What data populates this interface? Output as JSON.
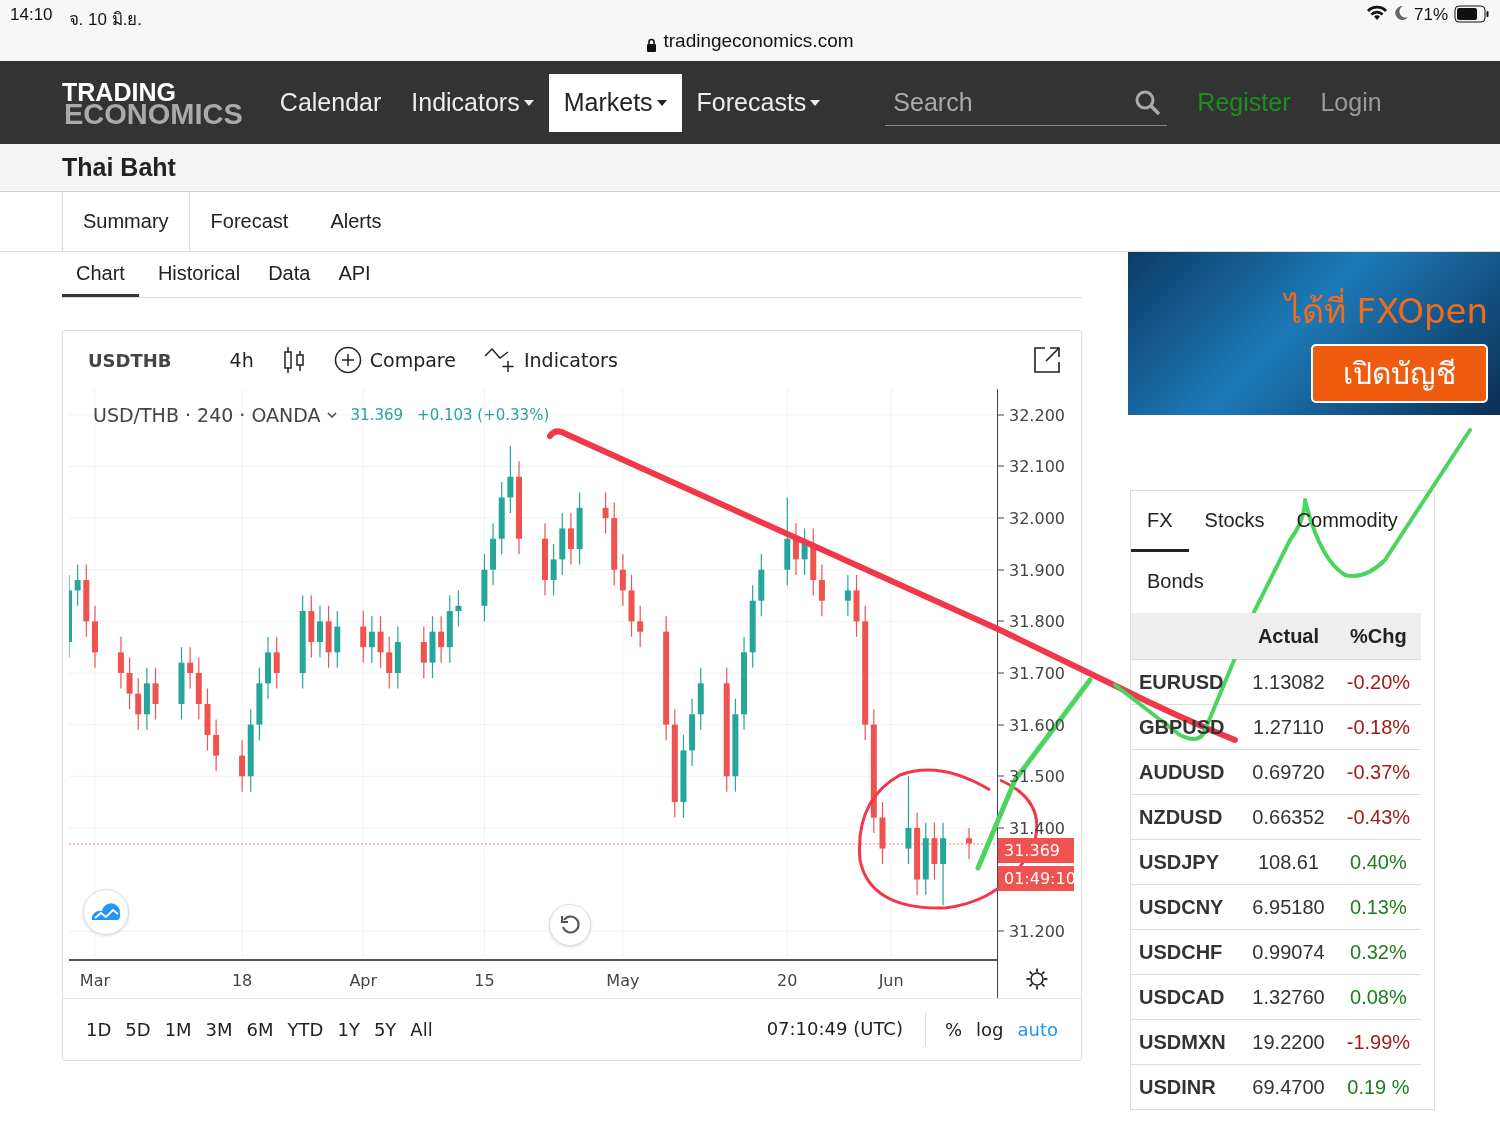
{
  "status_bar": {
    "time": "14:10",
    "date": "จ. 10 มิ.ย.",
    "url": "tradingeconomics.com",
    "battery": "71%"
  },
  "nav": {
    "logo_top": "TRADING",
    "logo_bottom": "ECONOMICS",
    "items": [
      {
        "label": "Calendar",
        "dropdown": false,
        "selected": false
      },
      {
        "label": "Indicators",
        "dropdown": true,
        "selected": false
      },
      {
        "label": "Markets",
        "dropdown": true,
        "selected": true
      },
      {
        "label": "Forecasts",
        "dropdown": true,
        "selected": false
      }
    ],
    "search": {
      "placeholder": "Search"
    },
    "register": "Register",
    "login": "Login"
  },
  "page_title": "Thai Baht",
  "tabs": [
    {
      "label": "Summary",
      "selected": true
    },
    {
      "label": "Forecast",
      "selected": false
    },
    {
      "label": "Alerts",
      "selected": false
    }
  ],
  "subtabs": [
    {
      "label": "Chart",
      "selected": true
    },
    {
      "label": "Historical",
      "selected": false
    },
    {
      "label": "Data",
      "selected": false
    },
    {
      "label": "API",
      "selected": false
    }
  ],
  "chart_widget": {
    "symbol": "USDTHB",
    "interval": "4h",
    "compare": "Compare",
    "indicators": "Indicators",
    "legend": {
      "title": "USD/THB · 240 · OANDA",
      "price": "31.369",
      "change": "+0.103 (+0.33%)"
    },
    "chart_data": {
      "type": "candlestick",
      "ylim": [
        31.15,
        32.25
      ],
      "grid": true,
      "ref_lines": [
        {
          "axis": "y",
          "value": 31.369,
          "color": "#ef5350"
        }
      ],
      "yticks": [
        {
          "value": 32.2,
          "label": "32.200"
        },
        {
          "value": 32.1,
          "label": "32.100"
        },
        {
          "value": 32.0,
          "label": "32.000"
        },
        {
          "value": 31.9,
          "label": "31.900"
        },
        {
          "value": 31.8,
          "label": "31.800"
        },
        {
          "value": 31.7,
          "label": "31.700"
        },
        {
          "value": 31.6,
          "label": "31.600"
        },
        {
          "value": 31.5,
          "label": "31.500"
        },
        {
          "value": 31.4,
          "label": "31.400"
        },
        {
          "value": 31.2,
          "label": "31.200"
        }
      ],
      "xlim": [
        "--02-26",
        "--06-13"
      ],
      "xticks": [
        {
          "value": "--03-01",
          "label": "Mar"
        },
        {
          "value": "--03-18",
          "label": "18"
        },
        {
          "value": "--04-01",
          "label": "Apr"
        },
        {
          "value": "--04-15",
          "label": "15"
        },
        {
          "value": "--05-01",
          "label": "May"
        },
        {
          "value": "--05-20",
          "label": "20"
        },
        {
          "value": "--06-01",
          "label": "Jun"
        }
      ],
      "x": [
        "--02-26",
        "--02-27",
        "--02-28",
        "--03-01",
        "--03-04",
        "--03-05",
        "--03-06",
        "--03-07",
        "--03-08",
        "--03-11",
        "--03-12",
        "--03-13",
        "--03-14",
        "--03-15",
        "--03-18",
        "--03-19",
        "--03-20",
        "--03-21",
        "--03-22",
        "--03-25",
        "--03-26",
        "--03-27",
        "--03-28",
        "--03-29",
        "--04-01",
        "--04-02",
        "--04-03",
        "--04-04",
        "--04-05",
        "--04-08",
        "--04-09",
        "--04-10",
        "--04-11",
        "--04-12",
        "--04-15",
        "--04-16",
        "--04-17",
        "--04-18",
        "--04-19",
        "--04-22",
        "--04-23",
        "--04-24",
        "--04-25",
        "--04-26",
        "--04-29",
        "--04-30",
        "--05-01",
        "--05-02",
        "--05-03",
        "--05-06",
        "--05-07",
        "--05-08",
        "--05-09",
        "--05-10",
        "--05-13",
        "--05-14",
        "--05-15",
        "--05-16",
        "--05-17",
        "--05-20",
        "--05-21",
        "--05-22",
        "--05-23",
        "--05-24",
        "--05-27",
        "--05-28",
        "--05-29",
        "--05-30",
        "--05-31",
        "--06-03",
        "--06-04",
        "--06-05",
        "--06-06",
        "--06-07",
        "--06-10"
      ],
      "ohlc": [
        [
          31.76,
          31.89,
          31.73,
          31.86
        ],
        [
          31.86,
          31.91,
          31.83,
          31.88
        ],
        [
          31.88,
          31.91,
          31.77,
          31.8
        ],
        [
          31.8,
          31.83,
          31.71,
          31.74
        ],
        [
          31.74,
          31.77,
          31.67,
          31.7
        ],
        [
          31.7,
          31.73,
          31.63,
          31.66
        ],
        [
          31.66,
          31.69,
          31.59,
          31.62
        ],
        [
          31.62,
          31.71,
          31.59,
          31.68
        ],
        [
          31.68,
          31.71,
          31.61,
          31.64
        ],
        [
          31.64,
          31.75,
          31.61,
          31.72
        ],
        [
          31.72,
          31.75,
          31.67,
          31.7
        ],
        [
          31.7,
          31.73,
          31.61,
          31.64
        ],
        [
          31.64,
          31.67,
          31.55,
          31.58
        ],
        [
          31.58,
          31.61,
          31.51,
          31.54
        ],
        [
          31.54,
          31.57,
          31.47,
          31.5
        ],
        [
          31.5,
          31.63,
          31.47,
          31.6
        ],
        [
          31.6,
          31.71,
          31.57,
          31.68
        ],
        [
          31.68,
          31.77,
          31.65,
          31.74
        ],
        [
          31.74,
          31.77,
          31.67,
          31.7
        ],
        [
          31.7,
          31.85,
          31.67,
          31.82
        ],
        [
          31.82,
          31.85,
          31.73,
          31.76
        ],
        [
          31.76,
          31.83,
          31.73,
          31.8
        ],
        [
          31.8,
          31.83,
          31.71,
          31.74
        ],
        [
          31.74,
          31.82,
          31.71,
          31.79
        ],
        [
          31.79,
          31.82,
          31.72,
          31.75
        ],
        [
          31.75,
          31.81,
          31.72,
          31.78
        ],
        [
          31.78,
          31.81,
          31.71,
          31.74
        ],
        [
          31.74,
          31.77,
          31.67,
          31.7
        ],
        [
          31.7,
          31.79,
          31.67,
          31.76
        ],
        [
          31.76,
          31.79,
          31.69,
          31.72
        ],
        [
          31.72,
          31.81,
          31.69,
          31.78
        ],
        [
          31.78,
          31.81,
          31.72,
          31.75
        ],
        [
          31.75,
          31.85,
          31.72,
          31.82
        ],
        [
          31.82,
          31.86,
          31.79,
          31.83
        ],
        [
          31.83,
          31.93,
          31.8,
          31.9
        ],
        [
          31.9,
          31.99,
          31.87,
          31.96
        ],
        [
          31.96,
          32.07,
          31.93,
          32.04
        ],
        [
          32.04,
          32.14,
          32.01,
          32.08
        ],
        [
          32.08,
          32.11,
          31.93,
          31.96
        ],
        [
          31.96,
          31.99,
          31.85,
          31.88
        ],
        [
          31.88,
          31.95,
          31.85,
          31.92
        ],
        [
          31.92,
          32.01,
          31.89,
          31.98
        ],
        [
          31.98,
          32.01,
          31.91,
          31.94
        ],
        [
          31.94,
          32.05,
          31.91,
          32.02
        ],
        [
          32.02,
          32.05,
          31.97,
          32.0
        ],
        [
          32.0,
          32.03,
          31.87,
          31.9
        ],
        [
          31.9,
          31.93,
          31.83,
          31.86
        ],
        [
          31.86,
          31.89,
          31.77,
          31.8
        ],
        [
          31.8,
          31.83,
          31.75,
          31.78
        ],
        [
          31.78,
          31.81,
          31.57,
          31.6
        ],
        [
          31.6,
          31.63,
          31.42,
          31.45
        ],
        [
          31.45,
          31.58,
          31.42,
          31.55
        ],
        [
          31.55,
          31.65,
          31.52,
          31.62
        ],
        [
          31.62,
          31.71,
          31.59,
          31.68
        ],
        [
          31.68,
          31.71,
          31.47,
          31.5
        ],
        [
          31.5,
          31.65,
          31.47,
          31.62
        ],
        [
          31.62,
          31.77,
          31.59,
          31.74
        ],
        [
          31.74,
          31.87,
          31.71,
          31.84
        ],
        [
          31.84,
          31.93,
          31.81,
          31.9
        ],
        [
          31.9,
          32.04,
          31.87,
          31.96
        ],
        [
          31.96,
          31.99,
          31.89,
          31.92
        ],
        [
          31.92,
          31.98,
          31.89,
          31.95
        ],
        [
          31.95,
          31.98,
          31.85,
          31.88
        ],
        [
          31.88,
          31.91,
          31.81,
          31.84
        ],
        [
          31.84,
          31.89,
          31.81,
          31.86
        ],
        [
          31.86,
          31.89,
          31.77,
          31.8
        ],
        [
          31.8,
          31.83,
          31.57,
          31.6
        ],
        [
          31.6,
          31.63,
          31.39,
          31.42
        ],
        [
          31.42,
          31.45,
          31.33,
          31.36
        ],
        [
          31.36,
          31.5,
          31.33,
          31.4
        ],
        [
          31.4,
          31.43,
          31.27,
          31.3
        ],
        [
          31.3,
          31.41,
          31.27,
          31.38
        ],
        [
          31.38,
          31.41,
          31.3,
          31.33
        ],
        [
          31.33,
          31.41,
          31.25,
          31.38
        ],
        [
          31.38,
          31.4,
          31.34,
          31.37
        ]
      ]
    },
    "last_price": "31.369",
    "countdown": "01:49:10",
    "ranges": [
      "1D",
      "5D",
      "1M",
      "3M",
      "6M",
      "YTD",
      "1Y",
      "5Y",
      "All"
    ],
    "clock": "07:10:49 (UTC)",
    "scale_options": [
      {
        "label": "%",
        "selected": false
      },
      {
        "label": "log",
        "selected": false
      },
      {
        "label": "auto",
        "selected": true
      }
    ]
  },
  "ad": {
    "headline": "ได้ที่ FXOpen",
    "button": "เปิดบัญชี"
  },
  "markets": {
    "tabs": [
      {
        "label": "FX",
        "selected": true
      },
      {
        "label": "Stocks",
        "selected": false
      },
      {
        "label": "Commodity",
        "selected": false
      },
      {
        "label": "Bonds",
        "selected": false
      }
    ],
    "columns": [
      "Actual",
      "%Chg"
    ],
    "rows": [
      {
        "name": "EURUSD",
        "actual": "1.13082",
        "change": "-0.20%",
        "color": "#a31b1b"
      },
      {
        "name": "GBPUSD",
        "actual": "1.27110",
        "change": "-0.18%",
        "color": "#a31b1b"
      },
      {
        "name": "AUDUSD",
        "actual": "0.69720",
        "change": "-0.37%",
        "color": "#a31b1b"
      },
      {
        "name": "NZDUSD",
        "actual": "0.66352",
        "change": "-0.43%",
        "color": "#a31b1b"
      },
      {
        "name": "USDJPY",
        "actual": "108.61",
        "change": "0.40%",
        "color": "#1e7d1e"
      },
      {
        "name": "USDCNY",
        "actual": "6.95180",
        "change": "0.13%",
        "color": "#1e7d1e"
      },
      {
        "name": "USDCHF",
        "actual": "0.99074",
        "change": "0.32%",
        "color": "#1e7d1e"
      },
      {
        "name": "USDCAD",
        "actual": "1.32760",
        "change": "0.08%",
        "color": "#1e7d1e"
      },
      {
        "name": "USDMXN",
        "actual": "19.2200",
        "change": "-1.99%",
        "color": "#a31b1b"
      },
      {
        "name": "USDINR",
        "actual": "69.4700",
        "change": "0.19 %",
        "color": "#1e7d1e"
      }
    ]
  }
}
